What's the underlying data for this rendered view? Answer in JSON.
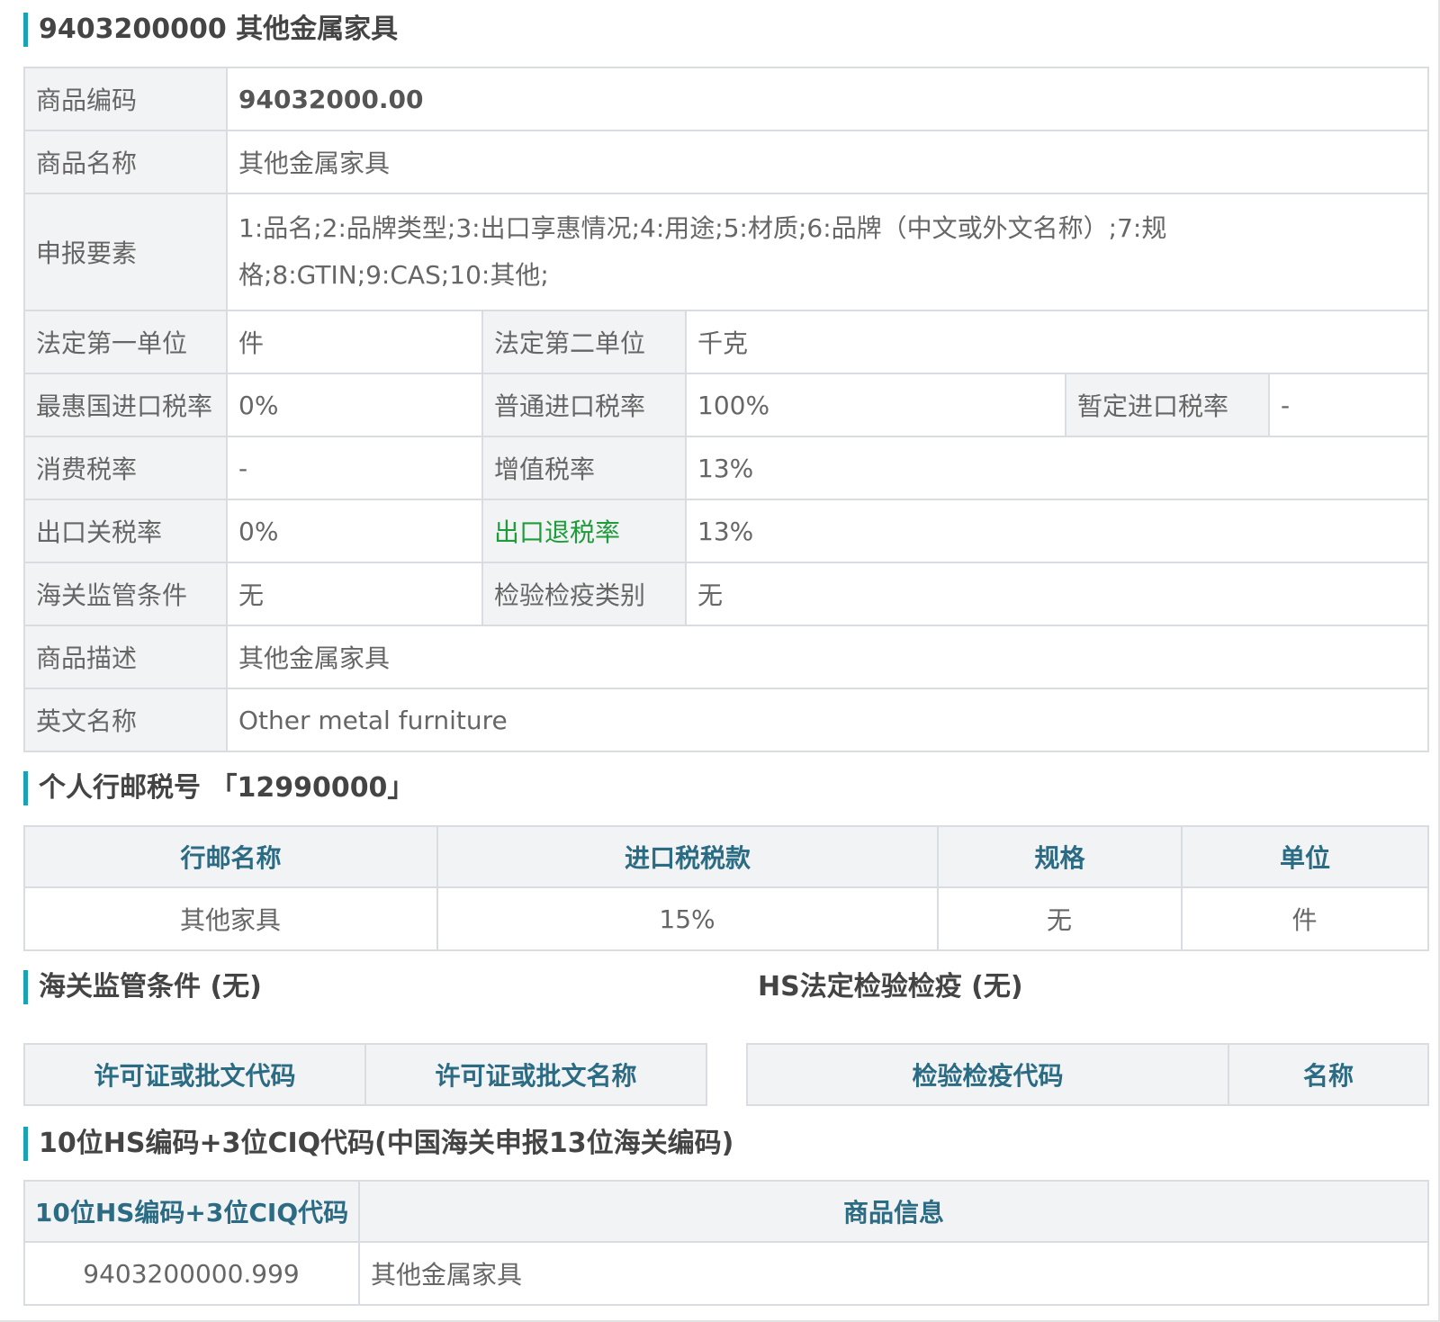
{
  "section1": {
    "title": "9403200000 其他金属家具",
    "rows": {
      "code_label": "商品编码",
      "code_value": "94032000.00",
      "name_label": "商品名称",
      "name_value": "其他金属家具",
      "elements_label": "申报要素",
      "elements_value": "1:品名;2:品牌类型;3:出口享惠情况;4:用途;5:材质;6:品牌（中文或外文名称）;7:规格;8:GTIN;9:CAS;10:其他;",
      "unit1_label": "法定第一单位",
      "unit1_value": "件",
      "unit2_label": "法定第二单位",
      "unit2_value": "千克",
      "mfn_label": "最惠国进口税率",
      "mfn_value": "0%",
      "general_label": "普通进口税率",
      "general_value": "100%",
      "provisional_label": "暂定进口税率",
      "provisional_value": "-",
      "consumption_label": "消费税率",
      "consumption_value": "-",
      "vat_label": "增值税率",
      "vat_value": "13%",
      "export_tariff_label": "出口关税率",
      "export_tariff_value": "0%",
      "export_rebate_label": "出口退税率",
      "export_rebate_value": "13%",
      "customs_label": "海关监管条件",
      "customs_value": "无",
      "inspection_label": "检验检疫类别",
      "inspection_value": "无",
      "desc_label": "商品描述",
      "desc_value": "其他金属家具",
      "en_label": "英文名称",
      "en_value": "Other metal furniture"
    }
  },
  "section2": {
    "title": "个人行邮税号 「12990000」",
    "headers": [
      "行邮名称",
      "进口税税款",
      "规格",
      "单位"
    ],
    "row": [
      "其他家具",
      "15%",
      "无",
      "件"
    ]
  },
  "section3": {
    "title": "海关监管条件 (无)",
    "headers": [
      "许可证或批文代码",
      "许可证或批文名称"
    ]
  },
  "section4": {
    "title": "HS法定检验检疫 (无)",
    "headers": [
      "检验检疫代码",
      "名称"
    ]
  },
  "section5": {
    "title": "10位HS编码+3位CIQ代码(中国海关申报13位海关编码)",
    "headers": [
      "10位HS编码+3位CIQ代码",
      "商品信息"
    ],
    "row": [
      "9403200000.999",
      "其他金属家具"
    ]
  },
  "colors": {
    "accent": "#1aa3b4",
    "header_text": "#2b6b84",
    "rebate_green": "#1e9c3a",
    "label_bg": "#f2f3f4"
  }
}
